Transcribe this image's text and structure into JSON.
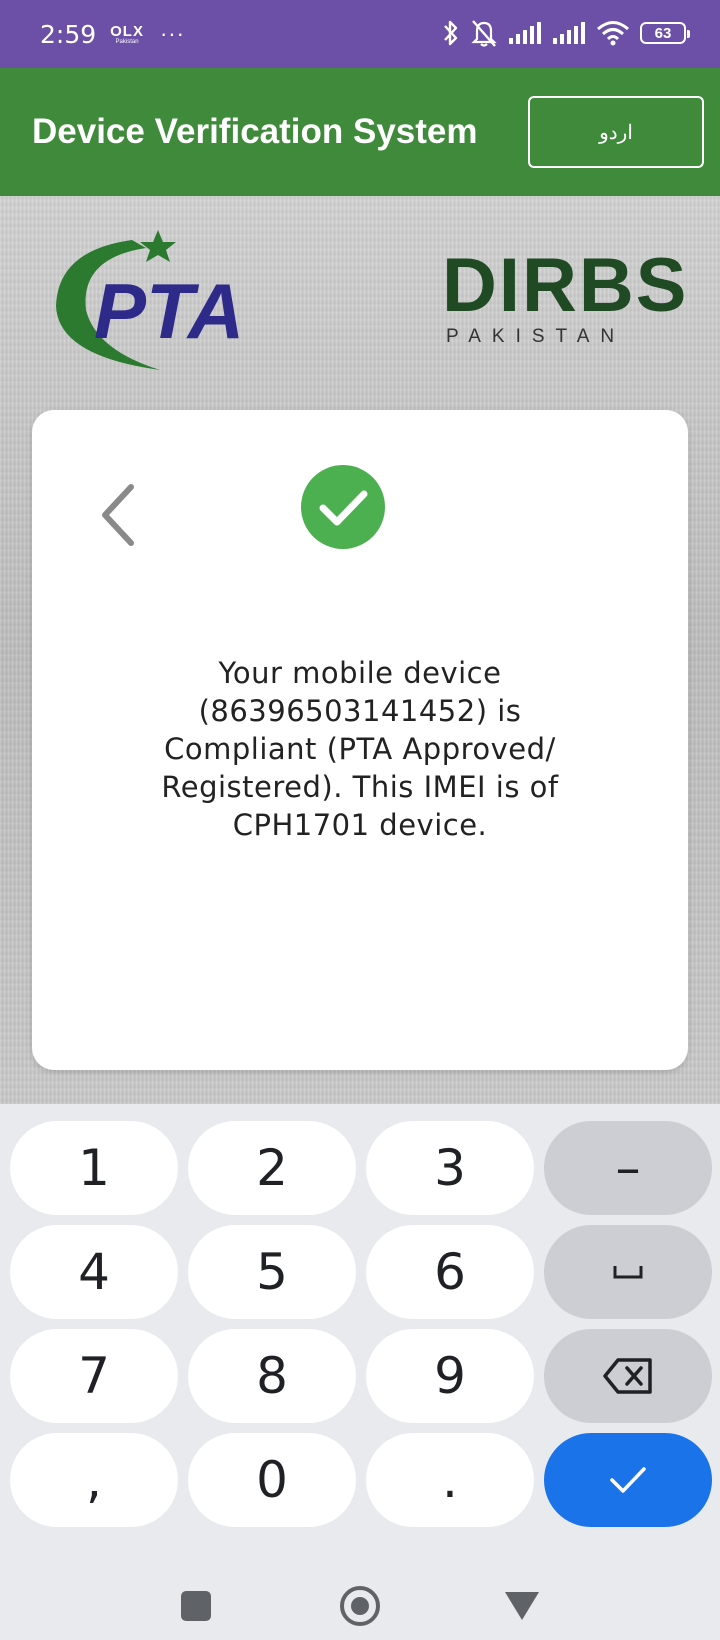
{
  "status_bar": {
    "time": "2:59",
    "olx_logo_text": "OLX",
    "olx_logo_sub": "Pakistan",
    "more_dots": "···",
    "battery_level": "63"
  },
  "app_bar": {
    "title": "Device Verification System",
    "language_button_label": "اردو"
  },
  "logos": {
    "pta_text": "PTA",
    "dirbs_text": "DIRBS",
    "dirbs_sub": "PAKISTAN"
  },
  "card": {
    "message": "Your mobile device (86396503141452) is Compliant (PTA Approved/ Registered). This IMEI is of CPH1701 device."
  },
  "keyboard": {
    "keys": {
      "k1": "1",
      "k2": "2",
      "k3": "3",
      "minus": "–",
      "k4": "4",
      "k5": "5",
      "k6": "6",
      "k7": "7",
      "k8": "8",
      "k9": "9",
      "comma": ",",
      "k0": "0",
      "period": "."
    }
  },
  "colors": {
    "status_bar": "#6c4fa6",
    "app_bar": "#3f8a3b",
    "success_green": "#4caf50",
    "enter_key": "#1a73e8"
  },
  "icons": {
    "back": "chevron-left-icon",
    "success": "check-circle-icon",
    "space": "space-icon",
    "backspace": "backspace-icon",
    "enter": "check-icon"
  }
}
